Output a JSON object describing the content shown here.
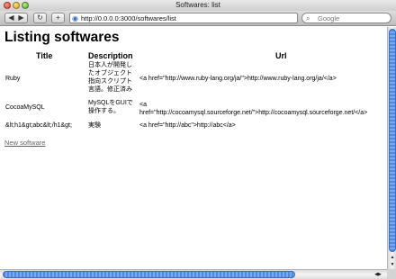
{
  "window": {
    "title": "Softwares: list"
  },
  "toolbar": {
    "back": "◀",
    "forward": "▶",
    "reload": "↻",
    "add": "+",
    "url": "http://0.0.0.0:3000/softwares/list",
    "search_placeholder": "Google"
  },
  "page": {
    "title": "Listing softwares",
    "headers": {
      "title": "Title",
      "description": "Description",
      "url": "Url"
    },
    "rows": [
      {
        "title": "Ruby",
        "description_lines": [
          "日本人が開発し",
          "たオブジェクト",
          "指向スクリプト",
          "言語。修正済み"
        ],
        "url_lines": [
          "<a href=\"http://www.ruby-lang.org/ja/\">http://www.ruby-lang.org/ja/</a>"
        ]
      },
      {
        "title": "CocoaMySQL",
        "description_lines": [
          "MySQLをGUIで",
          "操作する。"
        ],
        "url_lines": [
          "<a",
          "href=\"http://cocoamysql.sourceforge.net/\">http://cocoamysql.sourceforge.net/</a>"
        ]
      },
      {
        "title": "&lt;h1&gt;abc&lt;/h1&gt;",
        "description_lines": [
          "実験"
        ],
        "url_lines": [
          "<a href=\"http://abc\">http://abc</a>"
        ]
      }
    ],
    "new_link": "New software"
  }
}
